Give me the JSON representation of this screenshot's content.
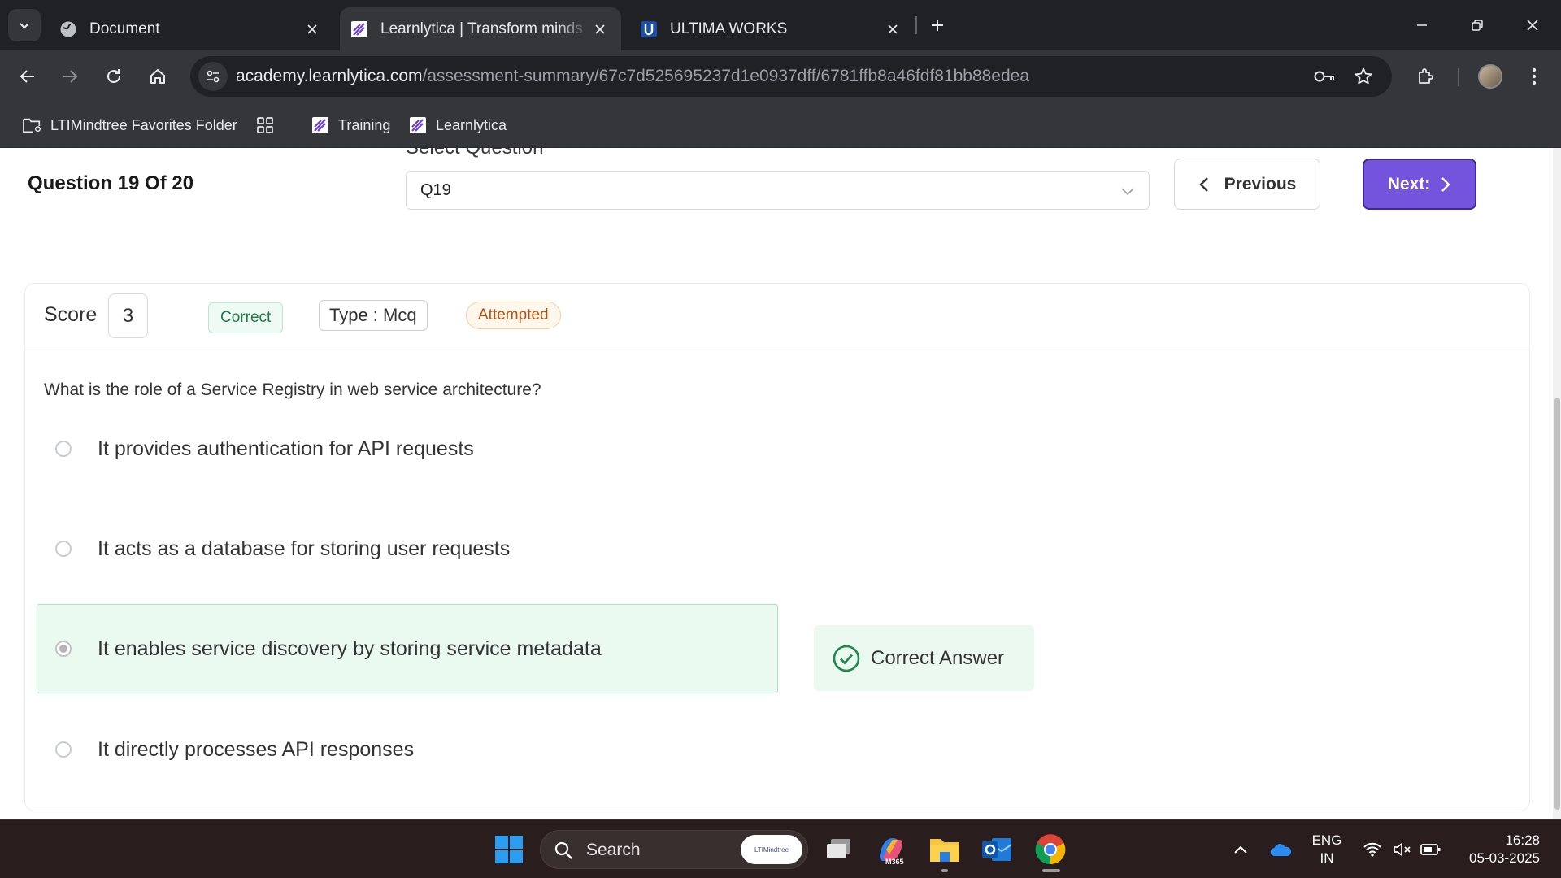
{
  "browser": {
    "tabs": [
      {
        "title": "Document"
      },
      {
        "title": "Learnlytica | Transform minds w"
      },
      {
        "title": "ULTIMA WORKS"
      }
    ],
    "url_host": "academy.learnlytica.com",
    "url_path": "/assessment-summary/67c7d525695237d1e0937dff/6781ffb8a46fdf81bb88edea",
    "bookmarks": [
      {
        "label": "LTIMindtree Favorites Folder"
      },
      {
        "label": "Training"
      },
      {
        "label": "Learnlytica"
      }
    ]
  },
  "header": {
    "question_count": "Question 19 Of 20",
    "select_label": "Select Question",
    "select_value": "Q19",
    "previous_label": "Previous",
    "next_label": "Next:"
  },
  "card": {
    "score_label": "Score",
    "score_value": "3",
    "status_badge": "Correct",
    "type_badge": "Type : Mcq",
    "attempt_badge": "Attempted",
    "question": "What is the role of a Service Registry in web service architecture?",
    "options": [
      {
        "text": "It provides authentication for API requests",
        "selected": false
      },
      {
        "text": "It acts as a database for storing user requests",
        "selected": false
      },
      {
        "text": "It enables service discovery by storing service metadata",
        "selected": true
      },
      {
        "text": "It directly processes API responses",
        "selected": false
      }
    ],
    "correct_answer_label": "Correct Answer"
  },
  "taskbar": {
    "search_placeholder": "Search",
    "search_badge": "LTIMindtree",
    "m365_label": "M365",
    "lang_line1": "ENG",
    "lang_line2": "IN",
    "time": "16:28",
    "date": "05-03-2025"
  },
  "colors": {
    "accent": "#7454dd",
    "correct_bg": "#eafaf1",
    "correct_text": "#1e7a48",
    "attempted_text": "#b4500f"
  }
}
